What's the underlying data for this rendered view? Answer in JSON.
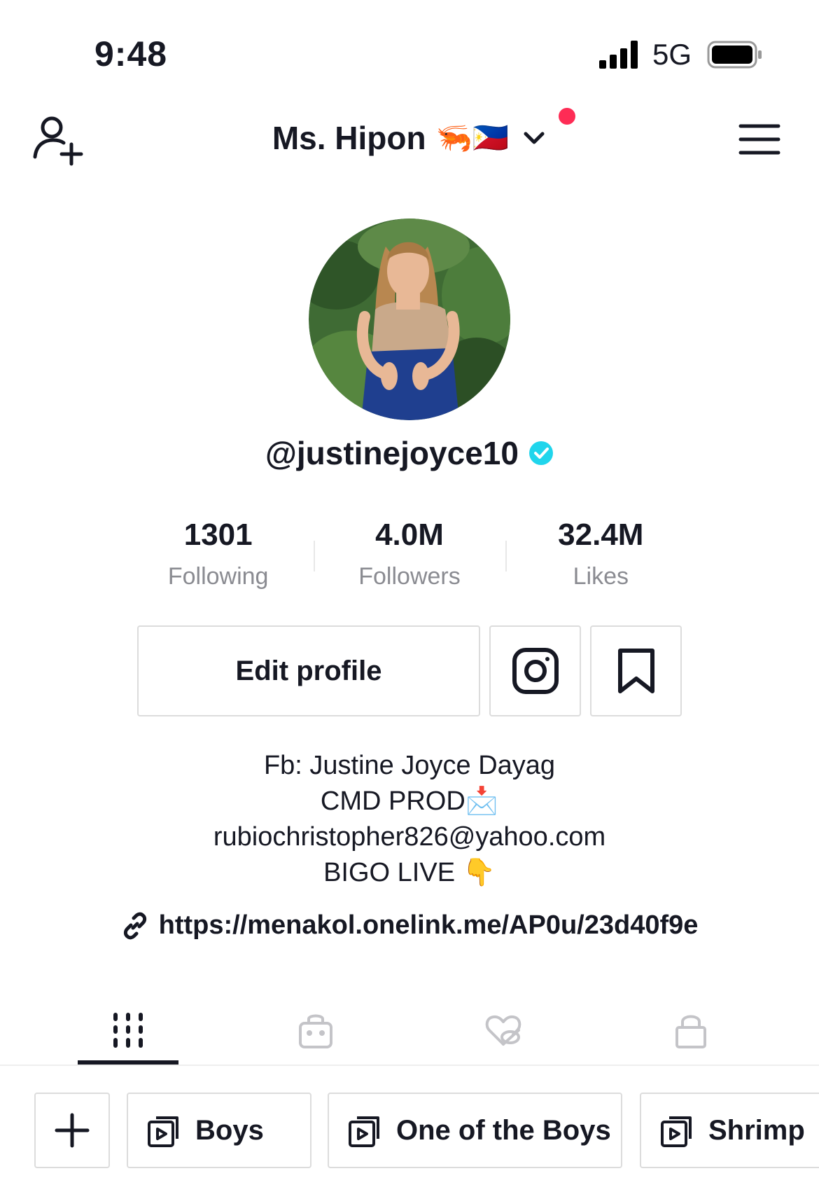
{
  "status_bar": {
    "time": "9:48",
    "network": "5G"
  },
  "header": {
    "title": "Ms. Hipon",
    "title_emoji": "🦐🇵🇭",
    "has_notification_dot": true
  },
  "profile": {
    "username": "@justinejoyce10",
    "verified": true,
    "stats": [
      {
        "value": "1301",
        "label": "Following"
      },
      {
        "value": "4.0M",
        "label": "Followers"
      },
      {
        "value": "32.4M",
        "label": "Likes"
      }
    ],
    "edit_label": "Edit profile",
    "bio": [
      "Fb: Justine Joyce Dayag",
      "CMD PROD📩",
      "rubiochristopher826@yahoo.com",
      "BIGO LIVE 👇"
    ],
    "link": "https://menakol.onelink.me/AP0u/23d40f9e"
  },
  "tabs": [
    {
      "name": "videos-grid-icon",
      "active": true
    },
    {
      "name": "shop-bag-icon",
      "active": false
    },
    {
      "name": "liked-hidden-icon",
      "active": false
    },
    {
      "name": "private-lock-icon",
      "active": false
    }
  ],
  "playlists": [
    {
      "label": "Boys"
    },
    {
      "label": "One of the Boys"
    },
    {
      "label": "Shrimp"
    }
  ],
  "colors": {
    "accent_red": "#fe2c55",
    "verified_blue": "#20d5ec",
    "text": "#161823",
    "muted": "#8a8b91"
  }
}
